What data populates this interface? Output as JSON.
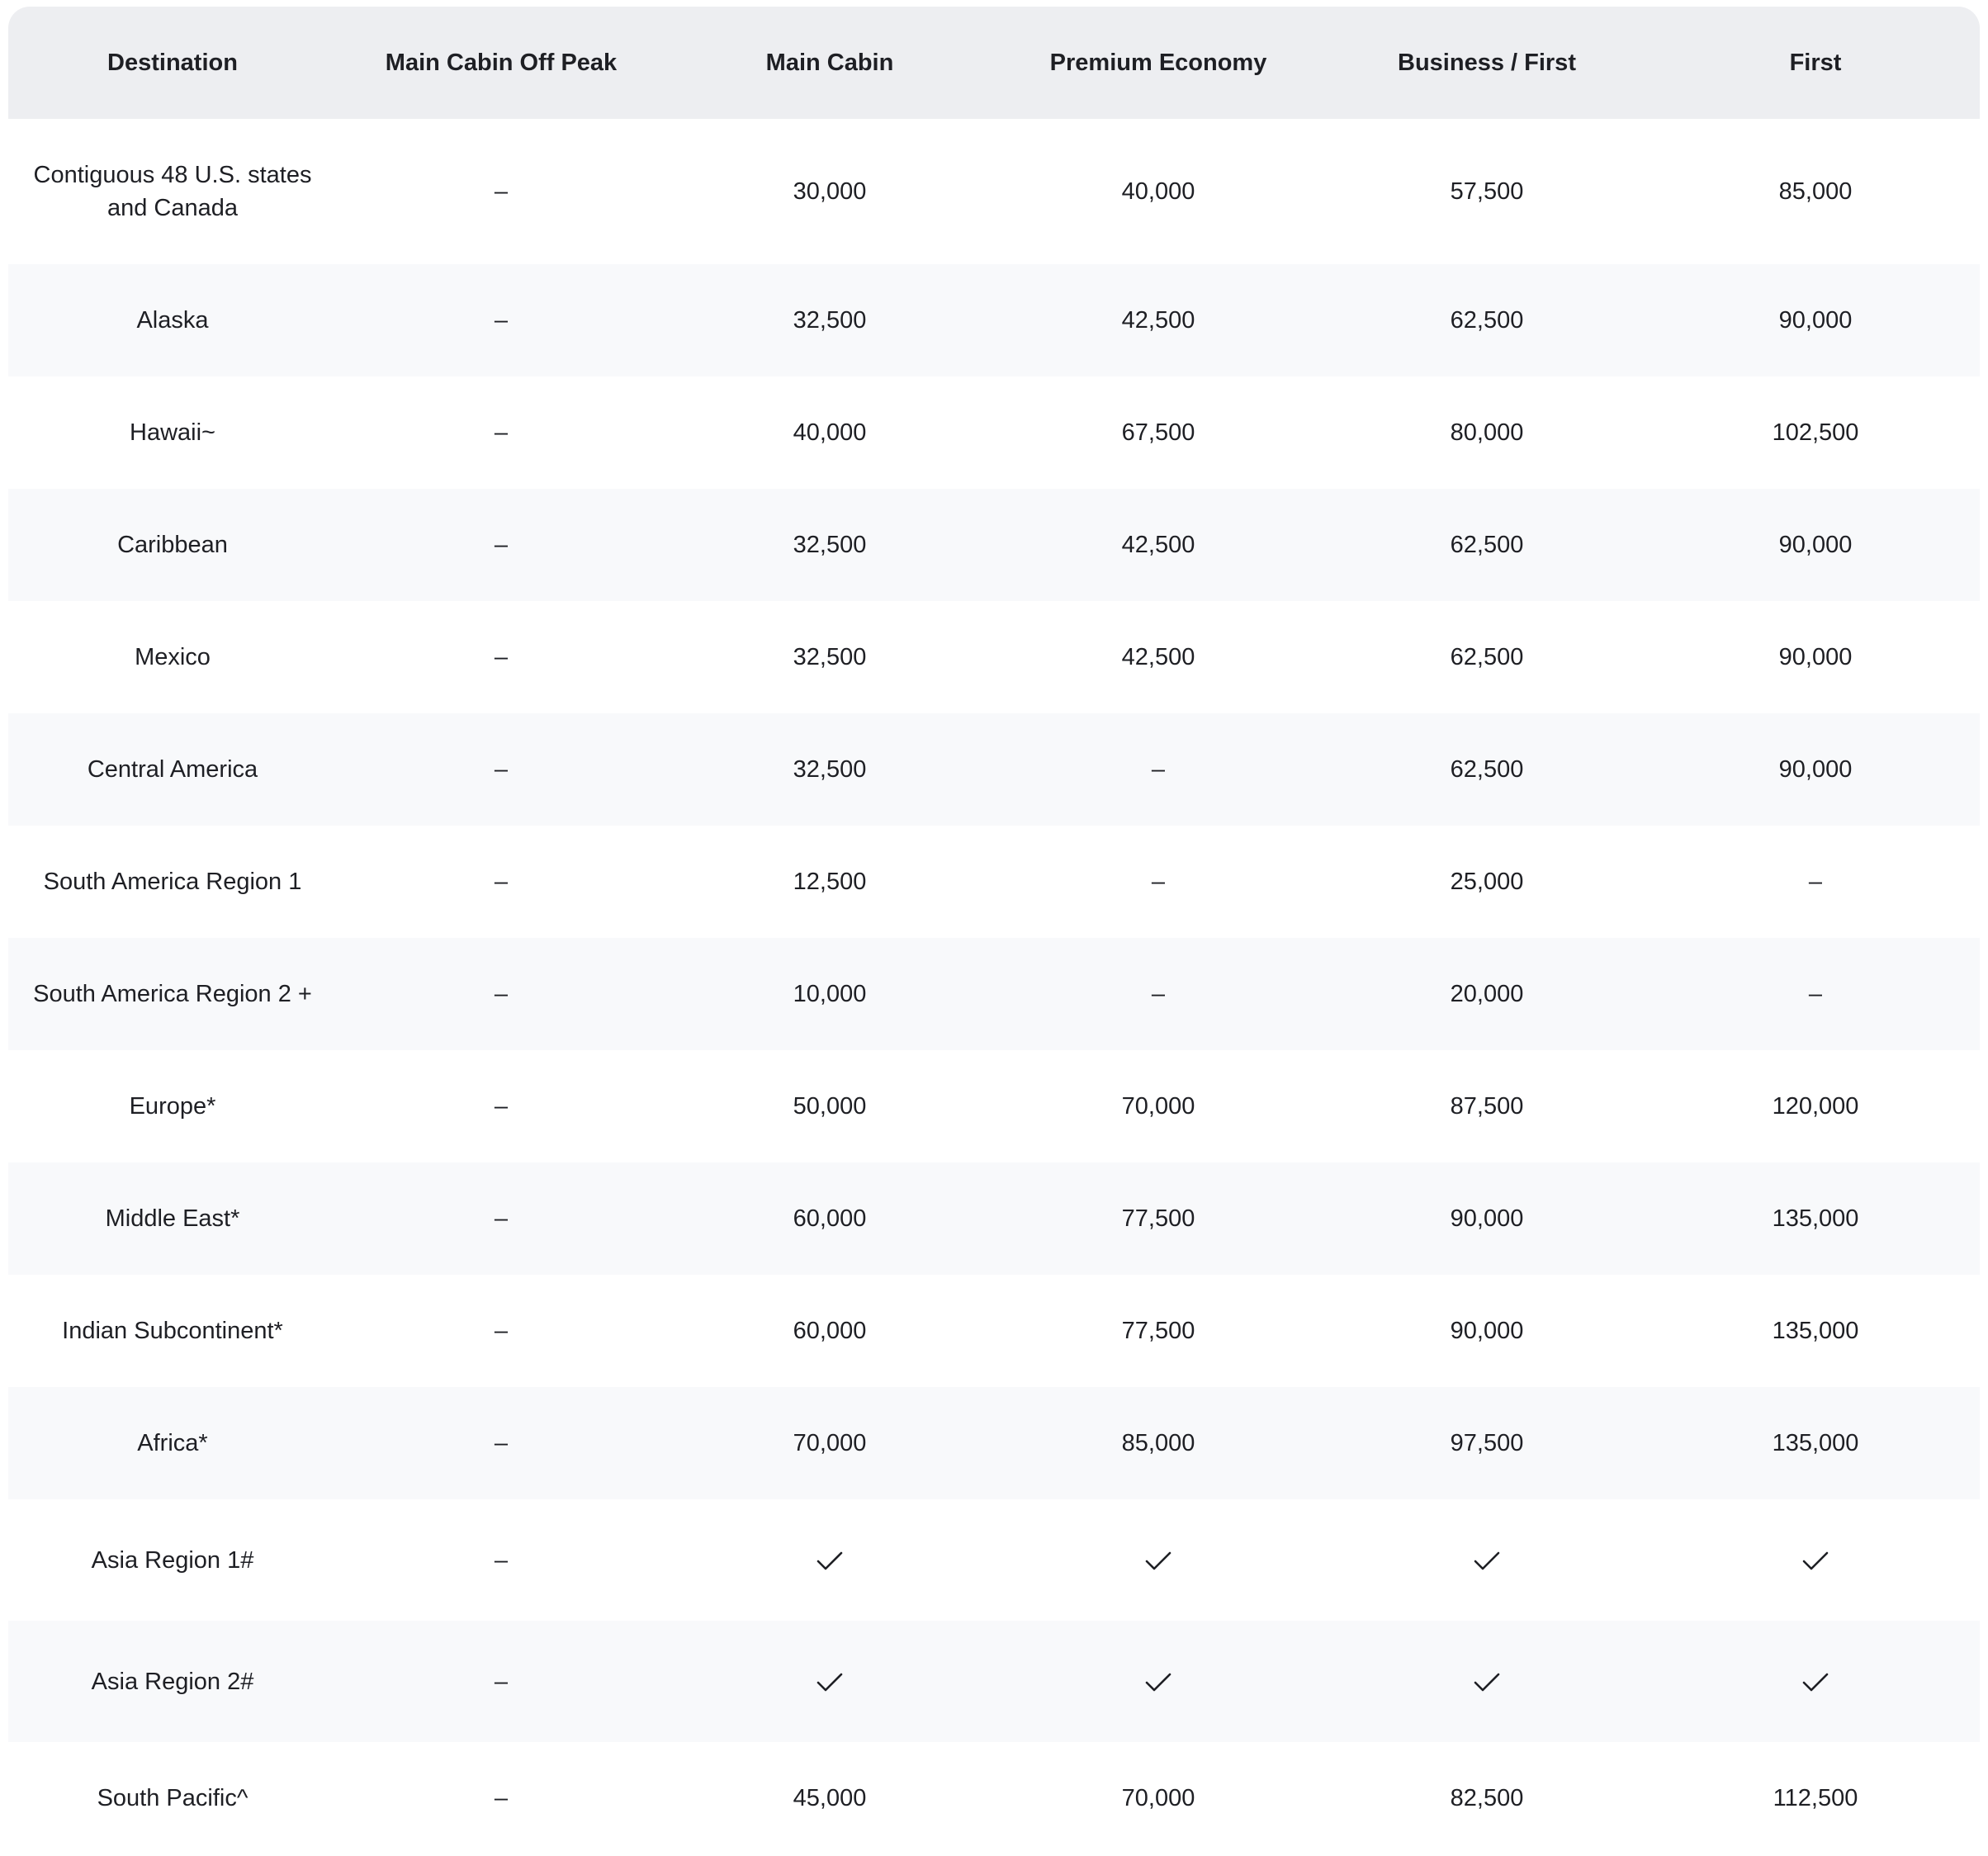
{
  "table": {
    "columns": [
      "Destination",
      "Main Cabin Off Peak",
      "Main Cabin",
      "Premium Economy",
      "Business / First",
      "First"
    ],
    "rows": [
      {
        "cells": [
          "Contiguous 48 U.S. states and Canada",
          "–",
          "30,000",
          "40,000",
          "57,500",
          "85,000"
        ]
      },
      {
        "cells": [
          "Alaska",
          "–",
          "32,500",
          "42,500",
          "62,500",
          "90,000"
        ]
      },
      {
        "cells": [
          "Hawaii~",
          "–",
          "40,000",
          "67,500",
          "80,000",
          "102,500"
        ]
      },
      {
        "cells": [
          "Caribbean",
          "–",
          "32,500",
          "42,500",
          "62,500",
          "90,000"
        ]
      },
      {
        "cells": [
          "Mexico",
          "–",
          "32,500",
          "42,500",
          "62,500",
          "90,000"
        ]
      },
      {
        "cells": [
          "Central America",
          "–",
          "32,500",
          "–",
          "62,500",
          "90,000"
        ]
      },
      {
        "cells": [
          "South America Region 1",
          "–",
          "12,500",
          "–",
          "25,000",
          "–"
        ]
      },
      {
        "cells": [
          "South America Region 2 +",
          "–",
          "10,000",
          "–",
          "20,000",
          "–"
        ]
      },
      {
        "cells": [
          "Europe*",
          "–",
          "50,000",
          "70,000",
          "87,500",
          "120,000"
        ]
      },
      {
        "cells": [
          "Middle East*",
          "–",
          "60,000",
          "77,500",
          "90,000",
          "135,000"
        ]
      },
      {
        "cells": [
          "Indian Subcontinent*",
          "–",
          "60,000",
          "77,500",
          "90,000",
          "135,000"
        ]
      },
      {
        "cells": [
          "Africa*",
          "–",
          "70,000",
          "85,000",
          "97,500",
          "135,000"
        ]
      },
      {
        "cells": [
          "Asia Region 1#",
          "–",
          "check-icon",
          "check-icon",
          "check-icon",
          "check-icon"
        ]
      },
      {
        "cells": [
          "Asia Region 2#",
          "–",
          "check-icon",
          "check-icon",
          "check-icon",
          "check-icon"
        ]
      },
      {
        "cells": [
          "South Pacific^",
          "–",
          "45,000",
          "70,000",
          "82,500",
          "112,500"
        ]
      }
    ]
  },
  "colors": {
    "header_bg": "#edeef1",
    "row_alt_bg": "#f8f9fb",
    "text": "#1e1f24"
  }
}
